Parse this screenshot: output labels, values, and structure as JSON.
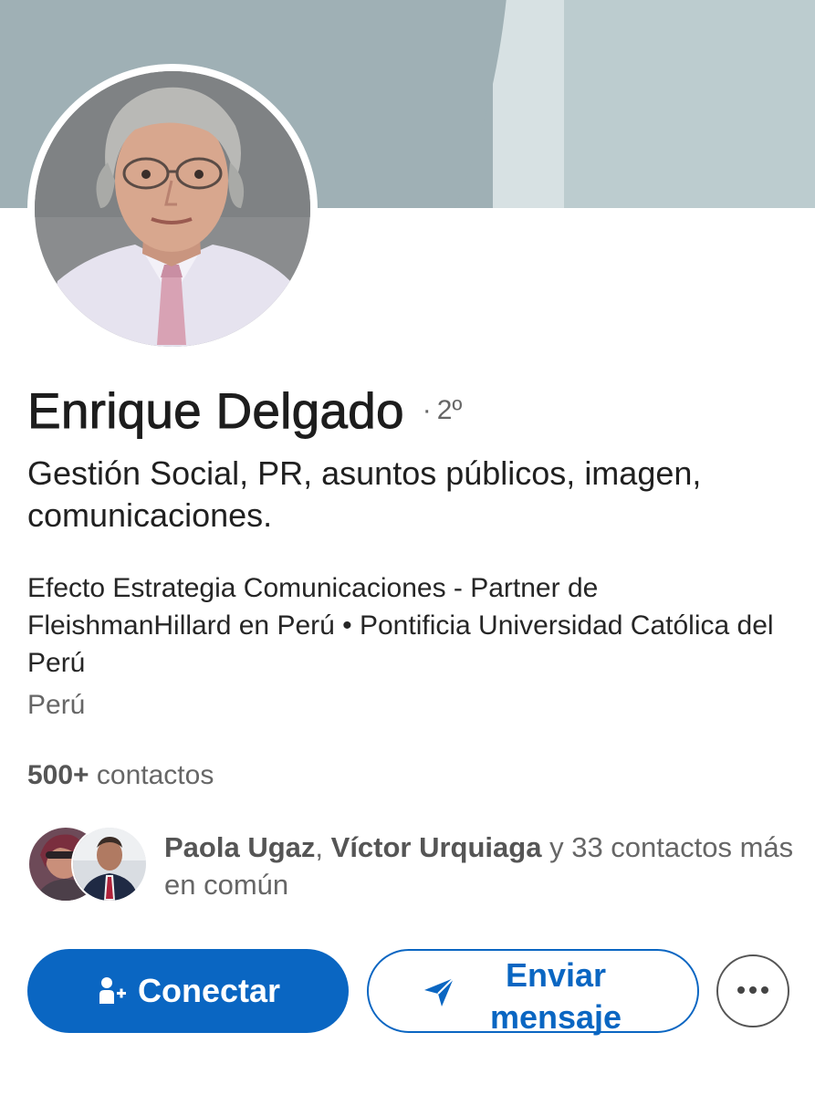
{
  "profile": {
    "name": "Enrique Delgado",
    "degree_separator": "·",
    "degree": "2º",
    "headline": "Gestión Social, PR, asuntos públicos, imagen, comunicaciones.",
    "company_line": "Efecto Estrategia Comunicaciones - Partner de FleishmanHillard en Perú • Pontificia Universidad Católica del Perú",
    "location": "Perú",
    "contacts_count": "500+",
    "contacts_label": "contactos"
  },
  "mutual": {
    "name_1": "Paola Ugaz",
    "separator": ",",
    "name_2": "Víctor Urquiaga",
    "rest": "y 33 contactos más en común"
  },
  "actions": {
    "connect_label": "Conectar",
    "message_label": "Enviar mensaje",
    "more_icon": "more-horizontal-icon",
    "connect_icon": "add-person-icon",
    "message_icon": "send-icon"
  },
  "colors": {
    "accent": "#0a66c2",
    "banner": "#9fb0b5",
    "banner_light": "#bccccf"
  }
}
